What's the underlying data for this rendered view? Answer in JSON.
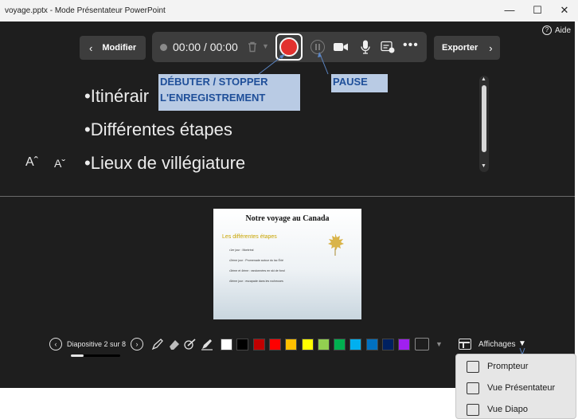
{
  "window": {
    "title": "voyage.pptx - Mode Présentateur PowerPoint",
    "minimize_glyph": "—",
    "maximize_glyph": "☐",
    "close_glyph": "✕"
  },
  "help": {
    "label": "Aide",
    "icon_glyph": "?"
  },
  "toolbar": {
    "modifier_label": "Modifier",
    "timer": "00:00 / 00:00",
    "exporter_label": "Exporter",
    "more_glyph": "•••"
  },
  "notes": {
    "lines": [
      "•Itinérair",
      "•Différentes étapes",
      "•Lieux de villégiature"
    ],
    "font_increase": "Aˆ",
    "font_decrease": "Aˇ"
  },
  "callouts": {
    "record": "DÉBUTER / STOPPER L'ENREGISTREMENT",
    "pause": "PAUSE"
  },
  "slide": {
    "title": "Notre voyage au Canada",
    "subtitle": "Les différentes étapes",
    "bullets": [
      "•1er jour : Montréal",
      "•2ème jour : Promenade autour du lac Érié",
      "•3ème et 4ème : randonnées en ski de fond",
      "•5ème jour : escapade dans les rocheuses"
    ]
  },
  "navigation": {
    "counter": "Diapositive 2 sur 8",
    "progress_fraction": 0.25
  },
  "colors": {
    "swatches": [
      "#ffffff",
      "#000000",
      "#c00000",
      "#ff0000",
      "#ffc000",
      "#ffff00",
      "#92d050",
      "#00b050",
      "#00b0f0",
      "#0070c0",
      "#002060",
      "#a020f0"
    ],
    "record_red": "#e2312f",
    "callout_bg": "#b9cbe4",
    "callout_text": "#1f4f99"
  },
  "views": {
    "label": "Affichages",
    "menu": [
      {
        "label": "Prompteur",
        "icon": "prompter-icon"
      },
      {
        "label": "Vue Présentateur",
        "icon": "presenter-view-icon"
      },
      {
        "label": "Vue Diapo",
        "icon": "slide-view-icon"
      }
    ]
  },
  "icons": [
    "help-icon",
    "chevron-left-icon",
    "record-dot-icon",
    "trash-icon",
    "record-icon",
    "pause-icon",
    "camera-icon",
    "microphone-icon",
    "subtitles-icon",
    "more-icon",
    "chevron-right-icon",
    "leaf-icon",
    "pen-icon",
    "eraser-icon",
    "highlighter-icon",
    "laser-icon",
    "avatar-icon",
    "views-icon"
  ]
}
